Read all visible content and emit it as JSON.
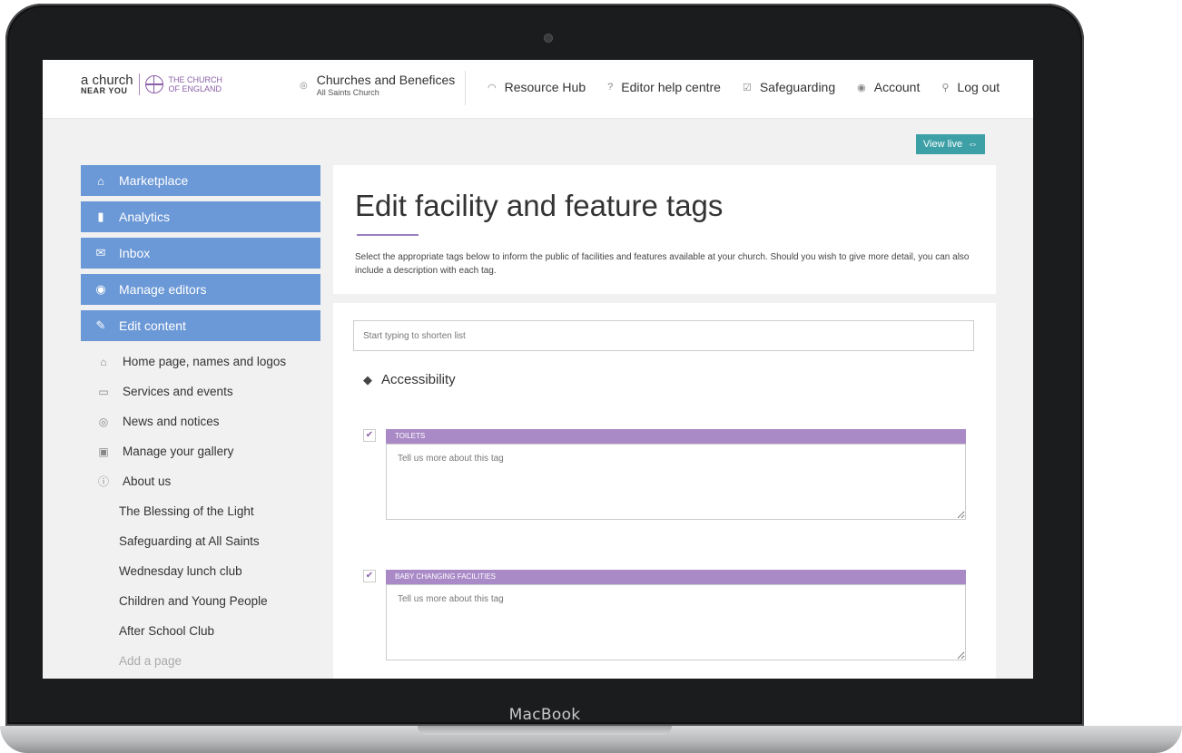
{
  "device": {
    "brand_label": "MacBook"
  },
  "header": {
    "logo": {
      "line1": "a church",
      "line2": "NEAR YOU",
      "coe1": "THE CHURCH",
      "coe2": "OF ENGLAND"
    },
    "church_selector": {
      "title": "Churches and Benefices",
      "subtitle": "All Saints Church"
    },
    "nav": [
      {
        "label": "Resource Hub",
        "icon": "broadcast-icon"
      },
      {
        "label": "Editor help centre",
        "icon": "help-icon"
      },
      {
        "label": "Safeguarding",
        "icon": "checkbox-icon"
      },
      {
        "label": "Account",
        "icon": "user-icon"
      },
      {
        "label": "Log out",
        "icon": "key-icon"
      }
    ]
  },
  "view_live": {
    "label": "View live"
  },
  "sidebar": {
    "buttons": [
      {
        "label": "Marketplace",
        "icon": "basket-icon"
      },
      {
        "label": "Analytics",
        "icon": "bar-chart-icon"
      },
      {
        "label": "Inbox",
        "icon": "envelope-icon"
      },
      {
        "label": "Manage editors",
        "icon": "user-circle-icon"
      },
      {
        "label": "Edit content",
        "icon": "pencil-icon"
      }
    ],
    "items": [
      {
        "label": "Home page, names and logos",
        "icon": "home-icon"
      },
      {
        "label": "Services and events",
        "icon": "calendar-icon"
      },
      {
        "label": "News and notices",
        "icon": "broadcast-icon"
      },
      {
        "label": "Manage your gallery",
        "icon": "image-icon"
      },
      {
        "label": "About us",
        "icon": "info-icon"
      }
    ],
    "pages": [
      "The Blessing of the Light",
      "Safeguarding at All Saints",
      "Wednesday lunch club",
      "Children and Young People",
      "After School Club"
    ],
    "add_page": "Add a page"
  },
  "main": {
    "title": "Edit facility and feature tags",
    "description": "Select the appropriate tags below to inform the public of facilities and features available at your church. Should you wish to give more detail, you can also include a description with each tag.",
    "search_placeholder": "Start typing to shorten list",
    "section_title": "Accessibility",
    "tags": [
      {
        "name": "TOILETS",
        "checked": true,
        "placeholder": "Tell us more about this tag"
      },
      {
        "name": "BABY CHANGING FACILITIES",
        "checked": true,
        "placeholder": "Tell us more about this tag"
      }
    ]
  },
  "colors": {
    "sidebar_button": "#6b98d6",
    "tag_label": "#a98ac7",
    "view_live": "#3da0a6",
    "accent": "#8b5fa6"
  }
}
